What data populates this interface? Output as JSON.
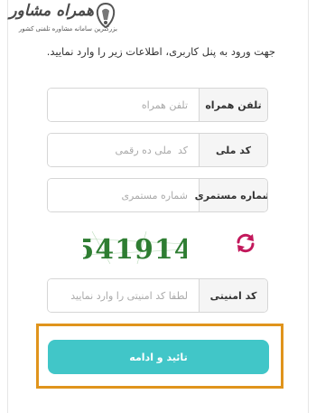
{
  "logo": {
    "name": "همراه مشاور",
    "tagline": "بزرگترین سامانه مشاوره تلفنی کشور"
  },
  "intro_text": "جهت ورود به پنل کاربری، اطلاعات زیر را وارد نمایید.",
  "form": {
    "phone": {
      "label": "تلفن همراه",
      "placeholder": "تلفن همراه",
      "value": ""
    },
    "national_id": {
      "label": "کد ملی",
      "placeholder": "کد  ملی ده رقمی",
      "value": ""
    },
    "customer_number": {
      "label": "شماره مستمری",
      "placeholder": "شماره مستمری",
      "value": ""
    },
    "captcha": {
      "code": "541914",
      "color": "#2e7d32"
    },
    "security_code": {
      "label": "کد امنیتی",
      "placeholder": "لطفا کد امنیتی را وارد نمایید",
      "value": ""
    },
    "submit_label": "تائید و ادامه"
  },
  "colors": {
    "accent": "#41c6c8",
    "highlight": "#e0941c",
    "refresh_icon": "#c2185b"
  }
}
